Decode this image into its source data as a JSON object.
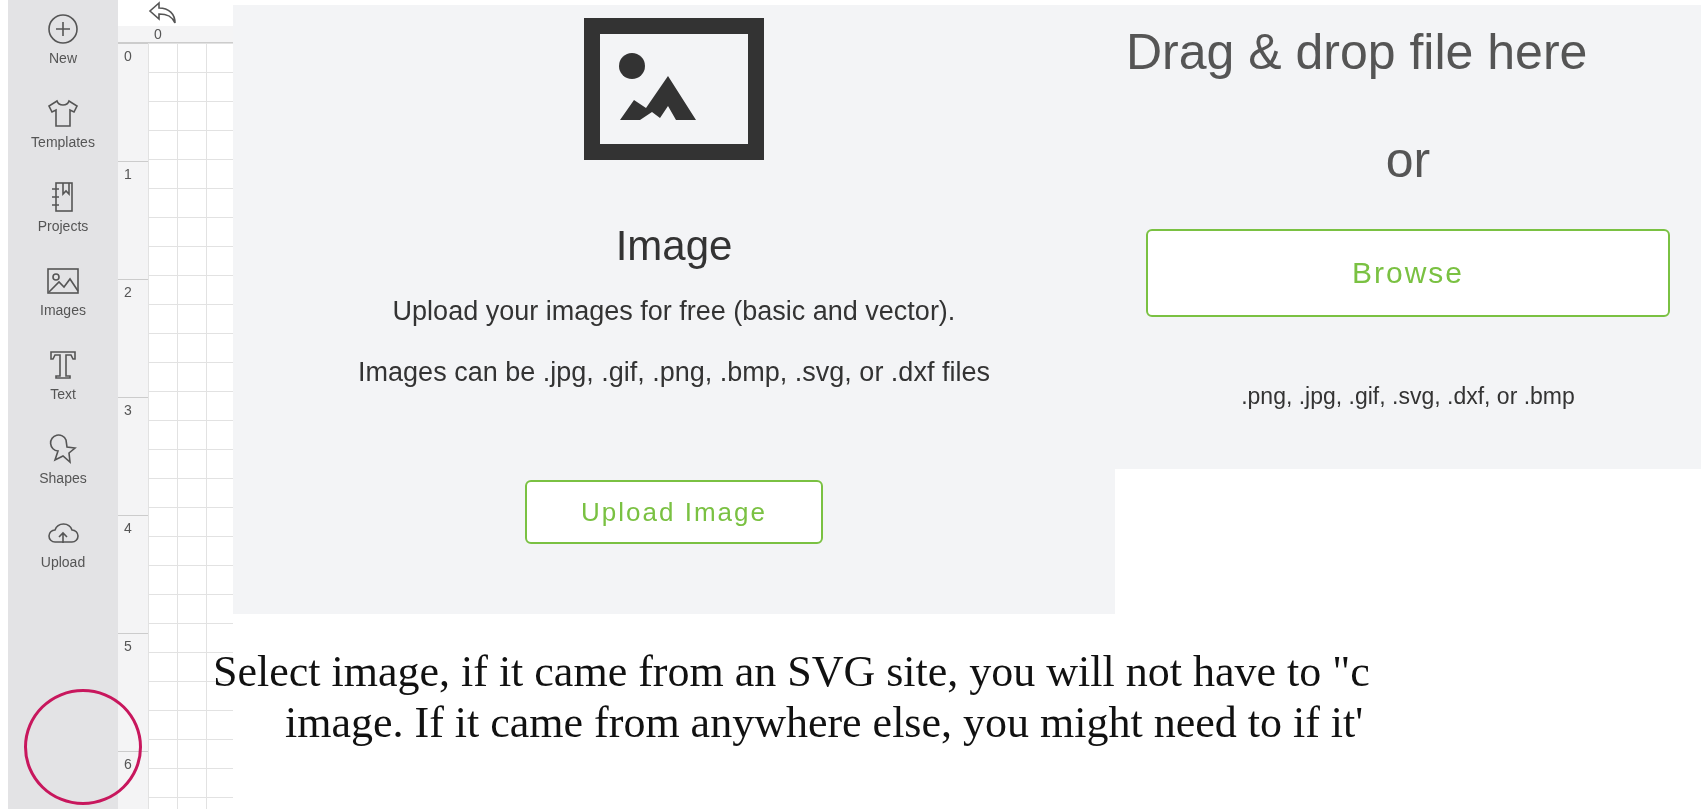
{
  "sidebar": {
    "items": [
      {
        "label": "New"
      },
      {
        "label": "Templates"
      },
      {
        "label": "Projects"
      },
      {
        "label": "Images"
      },
      {
        "label": "Text"
      },
      {
        "label": "Shapes"
      },
      {
        "label": "Upload"
      }
    ]
  },
  "canvas": {
    "top_ruler": [
      "0"
    ],
    "side_ruler": [
      "0",
      "1",
      "2",
      "3",
      "4",
      "5",
      "6"
    ]
  },
  "image_panel": {
    "title": "Image",
    "subtitle": "Upload your images for free (basic and vector).",
    "formats": "Images can be .jpg, .gif, .png, .bmp, .svg, or .dxf files",
    "button": "Upload Image"
  },
  "drop_panel": {
    "heading": "Drag & drop file here",
    "or": "or",
    "button": "Browse",
    "formats": ".png, .jpg, .gif, .svg, .dxf, or .bmp"
  },
  "caption": [
    "Select image, if it came from an SVG site, you will not have to \"c",
    "image. If it came from anywhere else, you might need to if it'"
  ]
}
